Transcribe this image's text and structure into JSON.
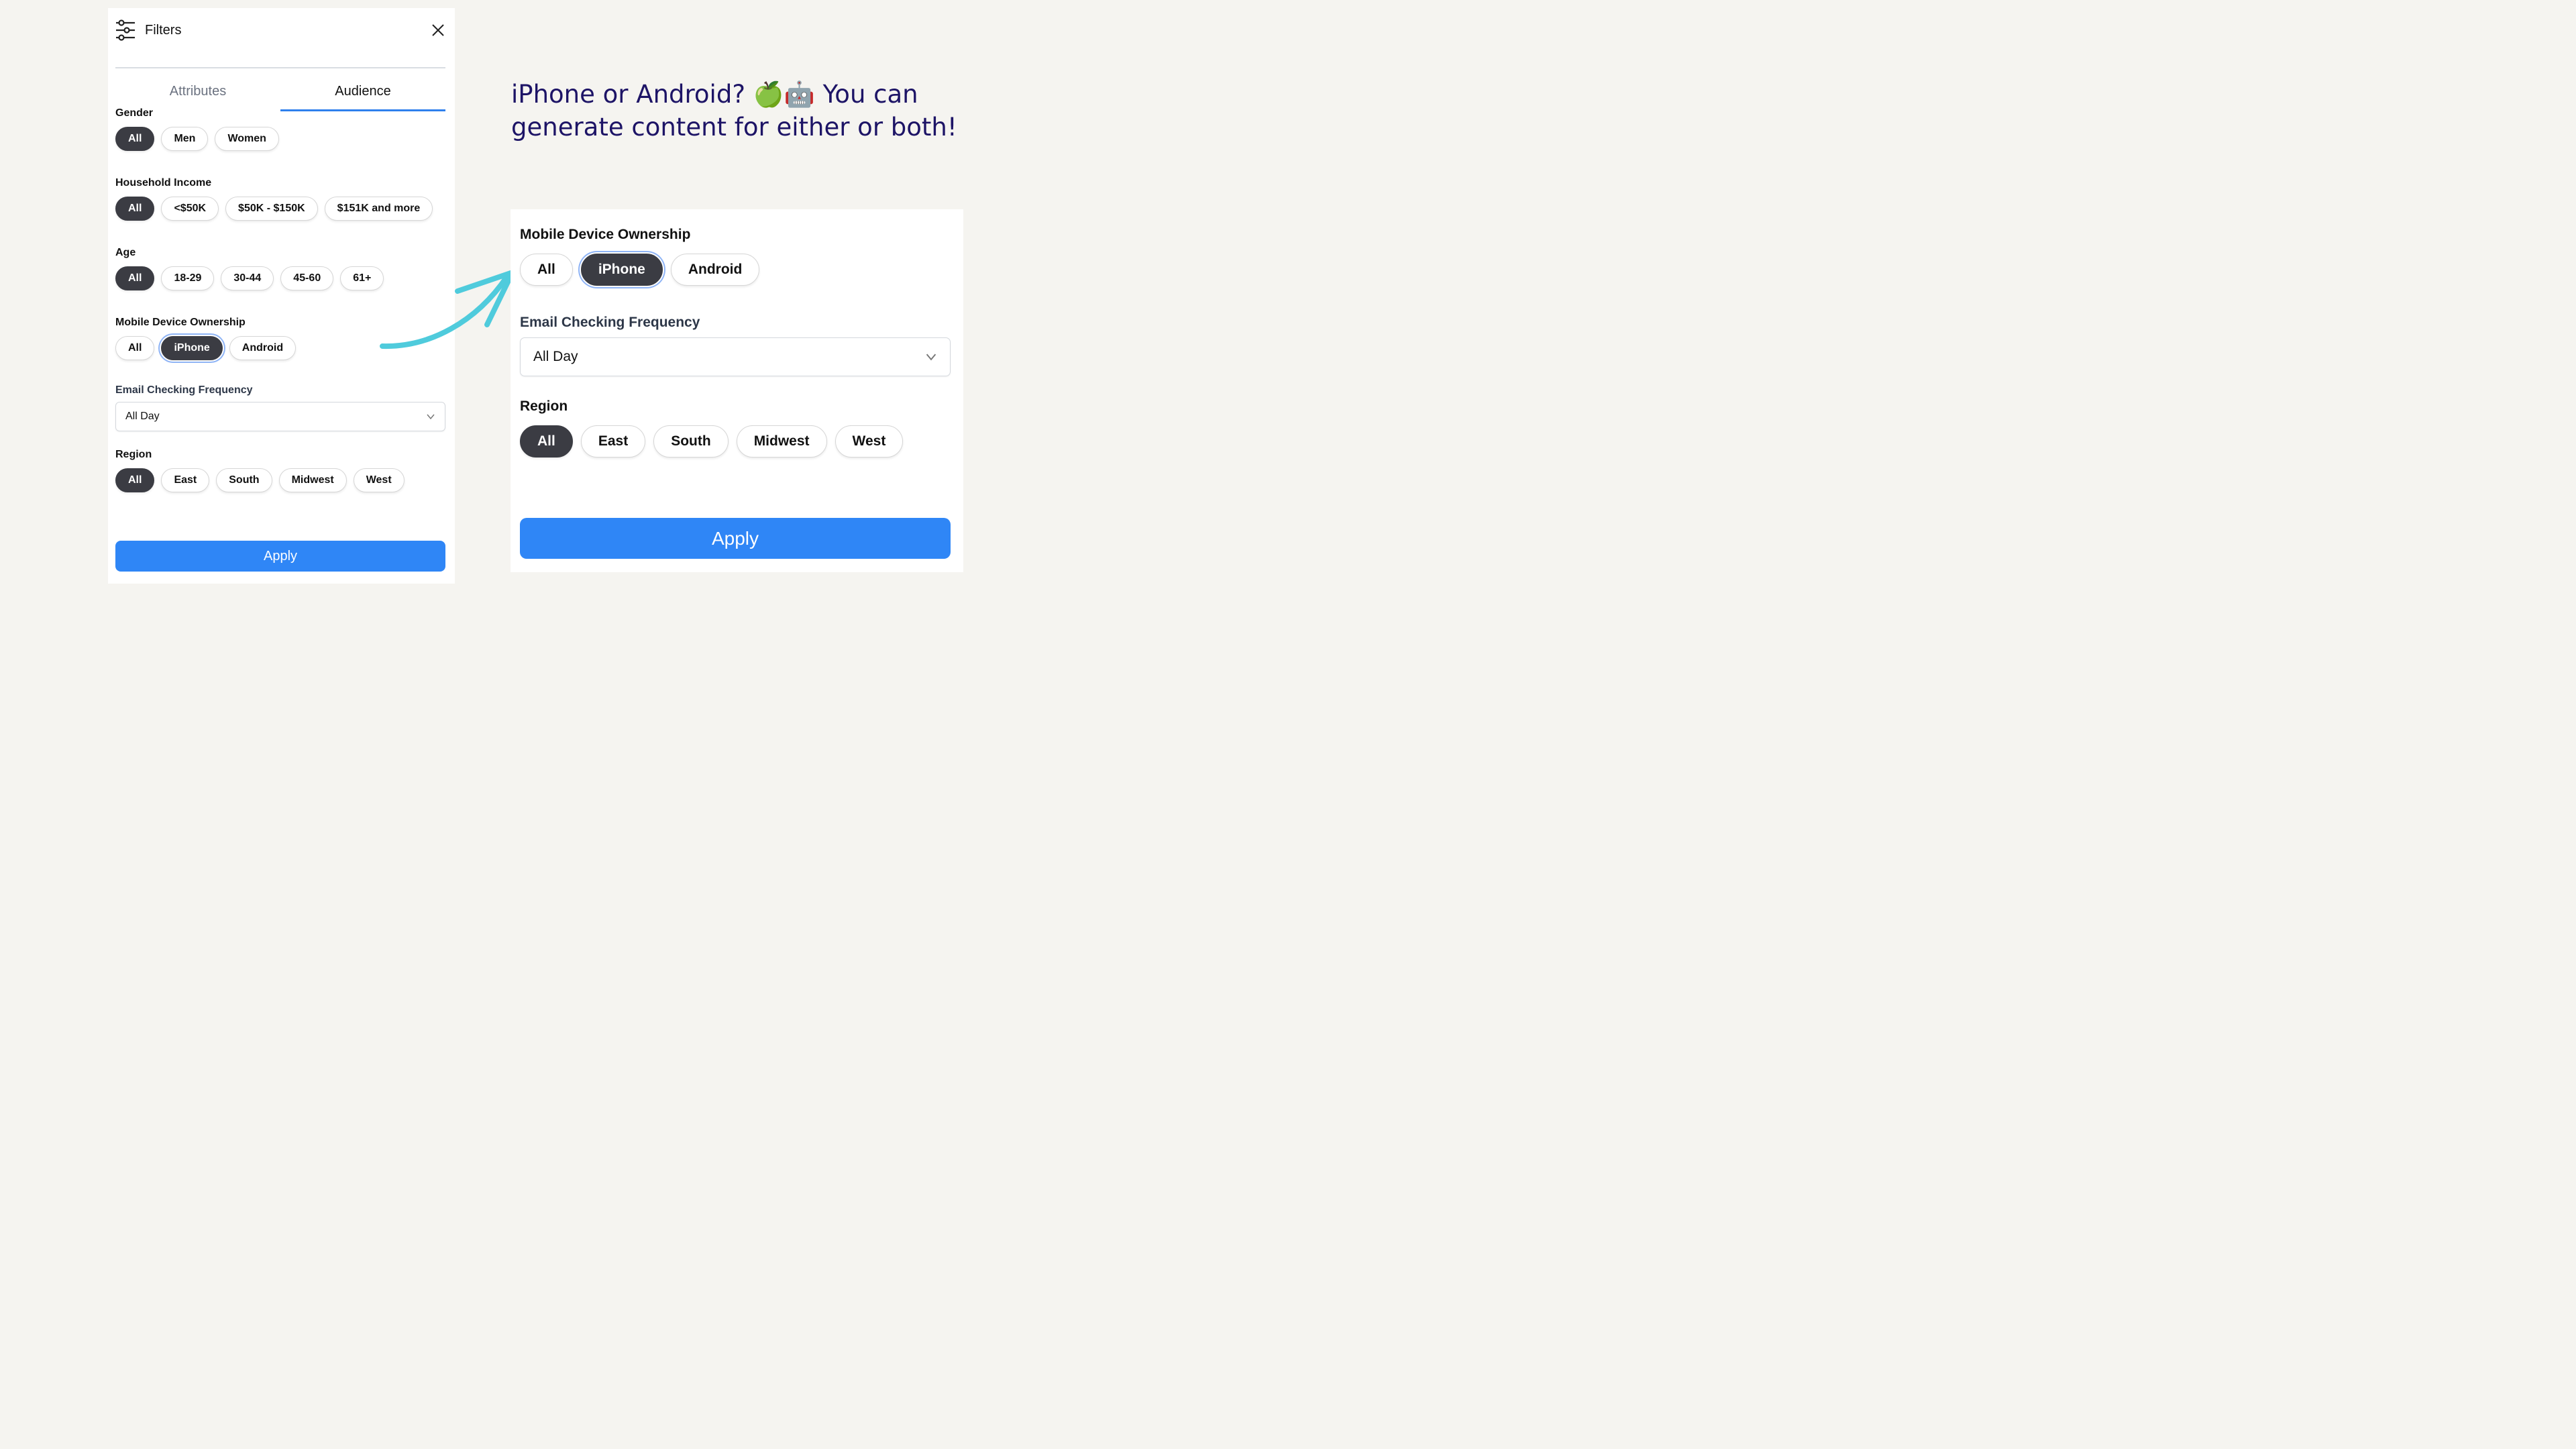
{
  "headline": {
    "line": "iPhone or Android? 🍏🤖 You can generate content for either or both!"
  },
  "colors": {
    "accent_blue": "#2f86f6",
    "selected_pill": "#3b3c43",
    "arrow": "#4fcbdc",
    "headline": "#1d1466",
    "background": "#f5f4f0"
  },
  "filters_panel": {
    "title": "Filters",
    "icons": {
      "header": "sliders-icon",
      "close": "close-icon",
      "select": "chevron-down-icon"
    },
    "tabs": [
      {
        "label": "Attributes",
        "active": false
      },
      {
        "label": "Audience",
        "active": true
      }
    ],
    "gender": {
      "label": "Gender",
      "options": [
        "All",
        "Men",
        "Women"
      ],
      "selected": "All"
    },
    "income": {
      "label": "Household Income",
      "options": [
        "All",
        "<$50K",
        "$50K - $150K",
        "$151K and more"
      ],
      "selected": "All"
    },
    "age": {
      "label": "Age",
      "options": [
        "All",
        "18-29",
        "30-44",
        "45-60",
        "61+"
      ],
      "selected": "All"
    },
    "mobile": {
      "label": "Mobile Device Ownership",
      "options": [
        "All",
        "iPhone",
        "Android"
      ],
      "selected": "iPhone"
    },
    "email": {
      "label": "Email Checking Frequency",
      "value": "All Day"
    },
    "region": {
      "label": "Region",
      "options": [
        "All",
        "East",
        "South",
        "Midwest",
        "West"
      ],
      "selected": "All"
    },
    "apply_label": "Apply"
  },
  "zoom_panel": {
    "mobile": {
      "label": "Mobile Device Ownership",
      "options": [
        "All",
        "iPhone",
        "Android"
      ],
      "selected": "iPhone"
    },
    "email": {
      "label": "Email Checking Frequency",
      "value": "All Day"
    },
    "region": {
      "label": "Region",
      "options": [
        "All",
        "East",
        "South",
        "Midwest",
        "West"
      ],
      "selected": "All"
    },
    "apply_label": "Apply"
  }
}
